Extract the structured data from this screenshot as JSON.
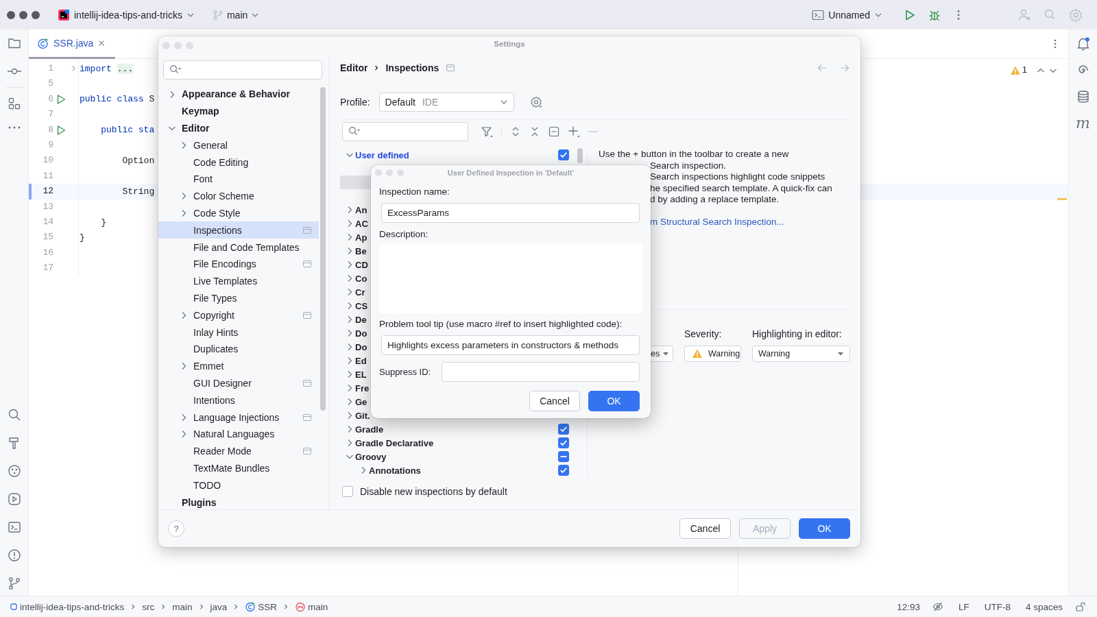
{
  "title_bar": {
    "project": "intellij-idea-tips-and-tricks",
    "branch": "main",
    "run_config": "Unnamed"
  },
  "editor": {
    "tab": {
      "label": "SSR.java",
      "selected": true
    },
    "lines": [
      {
        "number": "1",
        "current": false,
        "run": false,
        "fold": true,
        "tokens": [
          {
            "kind": "keyword",
            "text": "import"
          },
          {
            "kind": "folded",
            "text": "..."
          }
        ]
      },
      {
        "number": "5",
        "current": false,
        "run": false,
        "fold": false
      },
      {
        "number": "6",
        "current": false,
        "run": true,
        "fold": false,
        "tokens": [
          {
            "kind": "keyword",
            "text": "public class"
          },
          {
            "kind": "plain",
            "text": " S"
          }
        ]
      },
      {
        "number": "7",
        "current": false,
        "run": false,
        "fold": false
      },
      {
        "number": "8",
        "current": false,
        "run": true,
        "fold": false,
        "tokens": [
          {
            "kind": "keyword",
            "text": "    public sta"
          }
        ]
      },
      {
        "number": "9",
        "current": false,
        "run": false,
        "fold": false
      },
      {
        "number": "10",
        "current": false,
        "run": false,
        "fold": false,
        "tokens": [
          {
            "kind": "plain",
            "text": "        Option"
          }
        ]
      },
      {
        "number": "11",
        "current": false,
        "run": false,
        "fold": false
      },
      {
        "number": "12",
        "current": true,
        "run": false,
        "fold": false,
        "tokens": [
          {
            "kind": "plain",
            "text": "        String"
          }
        ]
      },
      {
        "number": "13",
        "current": false,
        "run": false,
        "fold": false
      },
      {
        "number": "14",
        "current": false,
        "run": false,
        "fold": false,
        "tokens": [
          {
            "kind": "plain",
            "text": "    }"
          }
        ]
      },
      {
        "number": "15",
        "current": false,
        "run": false,
        "fold": false,
        "tokens": [
          {
            "kind": "plain",
            "text": "}"
          }
        ]
      },
      {
        "number": "16",
        "current": false,
        "run": false,
        "fold": false
      },
      {
        "number": "17",
        "current": false,
        "run": false,
        "fold": false
      }
    ],
    "warnings": "1"
  },
  "right_toolbar": {
    "label": "m"
  },
  "settings": {
    "title": "Settings",
    "nav": [
      {
        "label": "Appearance & Behavior",
        "expanded": false,
        "selected": false,
        "project_scope": false
      },
      {
        "label": "Keymap",
        "selected": false,
        "project_scope": false
      },
      {
        "label": "Editor",
        "expanded": true,
        "selected": false,
        "project_scope": false,
        "children": [
          {
            "label": "General",
            "expanded": false,
            "selected": false,
            "project_scope": false
          },
          {
            "label": "Code Editing",
            "selected": false,
            "project_scope": false
          },
          {
            "label": "Font",
            "selected": false,
            "project_scope": false
          },
          {
            "label": "Color Scheme",
            "expanded": false,
            "selected": false,
            "project_scope": false
          },
          {
            "label": "Code Style",
            "expanded": false,
            "selected": false,
            "project_scope": false
          },
          {
            "label": "Inspections",
            "selected": true,
            "project_scope": true
          },
          {
            "label": "File and Code Templates",
            "selected": false,
            "project_scope": false
          },
          {
            "label": "File Encodings",
            "selected": false,
            "project_scope": true
          },
          {
            "label": "Live Templates",
            "selected": false,
            "project_scope": false
          },
          {
            "label": "File Types",
            "selected": false,
            "project_scope": false
          },
          {
            "label": "Copyright",
            "expanded": false,
            "selected": false,
            "project_scope": true
          },
          {
            "label": "Inlay Hints",
            "selected": false,
            "project_scope": false
          },
          {
            "label": "Duplicates",
            "selected": false,
            "project_scope": false
          },
          {
            "label": "Emmet",
            "expanded": false,
            "selected": false,
            "project_scope": false
          },
          {
            "label": "GUI Designer",
            "selected": false,
            "project_scope": true
          },
          {
            "label": "Intentions",
            "selected": false,
            "project_scope": false
          },
          {
            "label": "Language Injections",
            "expanded": false,
            "selected": false,
            "project_scope": true
          },
          {
            "label": "Natural Languages",
            "expanded": false,
            "selected": false,
            "project_scope": false
          },
          {
            "label": "Reader Mode",
            "selected": false,
            "project_scope": true
          },
          {
            "label": "TextMate Bundles",
            "selected": false,
            "project_scope": false
          },
          {
            "label": "TODO",
            "selected": false,
            "project_scope": false
          }
        ]
      },
      {
        "label": "Plugins",
        "selected": false,
        "project_scope": false
      }
    ],
    "breadcrumb": [
      "Editor",
      "Inspections"
    ],
    "profile": {
      "label": "Profile:",
      "value": "Default",
      "scope": "IDE"
    },
    "inspections": [
      {
        "label": "User defined",
        "modified": true,
        "expanded": true,
        "selected": false,
        "checked": true,
        "partial": false,
        "children": [
          {
            "kind": "covered",
            "selected": false
          },
          {
            "kind": "covered",
            "selected": true
          },
          {
            "kind": "covered",
            "selected": false
          }
        ]
      },
      {
        "label": "An",
        "modified": false,
        "expanded": false,
        "selected": false
      },
      {
        "label": "AC",
        "modified": false,
        "expanded": false,
        "selected": false
      },
      {
        "label": "Ap",
        "modified": false,
        "expanded": false,
        "selected": false
      },
      {
        "label": "Be",
        "modified": false,
        "expanded": false,
        "selected": false
      },
      {
        "label": "CD",
        "modified": false,
        "expanded": false,
        "selected": false
      },
      {
        "label": "Co",
        "modified": false,
        "expanded": false,
        "selected": false
      },
      {
        "label": "Cr",
        "modified": false,
        "expanded": false,
        "selected": false
      },
      {
        "label": "CS",
        "modified": false,
        "expanded": false,
        "selected": false
      },
      {
        "label": "De",
        "modified": false,
        "expanded": false,
        "selected": false
      },
      {
        "label": "Do",
        "modified": false,
        "expanded": false,
        "selected": false
      },
      {
        "label": "Do",
        "modified": false,
        "expanded": false,
        "selected": false
      },
      {
        "label": "Ed",
        "modified": false,
        "expanded": false,
        "selected": false
      },
      {
        "label": "EL",
        "modified": false,
        "expanded": false,
        "selected": false
      },
      {
        "label": "Fre",
        "modified": false,
        "expanded": false,
        "selected": false
      },
      {
        "label": "Ge",
        "modified": false,
        "expanded": false,
        "selected": false
      },
      {
        "label": "Git.",
        "modified": false,
        "expanded": false,
        "selected": false
      },
      {
        "label": "Gradle",
        "modified": false,
        "expanded": false,
        "selected": false,
        "checked": true,
        "partial": false
      },
      {
        "label": "Gradle Declarative",
        "modified": false,
        "expanded": false,
        "selected": false,
        "checked": true,
        "partial": false
      },
      {
        "label": "Groovy",
        "modified": false,
        "expanded": true,
        "selected": false,
        "checked": true,
        "partial": true,
        "children": [
          {
            "label": "Annotations",
            "modified": false,
            "expanded": false,
            "selected": false,
            "checked": true,
            "partial": false
          }
        ]
      }
    ],
    "description": {
      "lines": [
        "Use the + button in the toolbar to create a new",
        "Search inspection.",
        "Search inspections highlight code snippets",
        "he specified search template. A quick-fix can",
        "d by adding a replace template."
      ],
      "link": "m Structural Search Inspection..."
    },
    "scope_value": "es",
    "severity": {
      "label": "Severity:",
      "value": "Warning"
    },
    "highlighting": {
      "label": "Highlighting in editor:",
      "value": "Warning"
    },
    "disable_new": {
      "label": "Disable new inspections by default",
      "checked": false
    },
    "help": "?",
    "buttons": [
      {
        "label": "Cancel",
        "kind": "default",
        "disabled": false
      },
      {
        "label": "Apply",
        "kind": "default",
        "disabled": true
      },
      {
        "label": "OK",
        "kind": "primary",
        "disabled": false
      }
    ]
  },
  "dialog": {
    "title": "User Defined Inspection in 'Default'",
    "name_label": "Inspection name:",
    "name_value": "ExcessParams",
    "description_label": "Description:",
    "tooltip_label": "Problem tool tip (use macro #ref to insert highlighted code):",
    "tooltip_value": "Highlights excess parameters in constructors & methods",
    "suppress_label": "Suppress ID:",
    "buttons": [
      {
        "label": "Cancel",
        "kind": "default"
      },
      {
        "label": "OK",
        "kind": "primary"
      }
    ]
  },
  "status_bar": {
    "path": [
      {
        "label": "intellij-idea-tips-and-tricks",
        "kind": "module"
      },
      {
        "label": "src",
        "kind": "folder"
      },
      {
        "label": "main",
        "kind": "folder"
      },
      {
        "label": "java",
        "kind": "folder"
      },
      {
        "label": "SSR",
        "kind": "class"
      },
      {
        "label": "main",
        "kind": "method"
      }
    ],
    "position": "12:93",
    "line_separator": "LF",
    "encoding": "UTF-8",
    "indent": "4 spaces"
  }
}
